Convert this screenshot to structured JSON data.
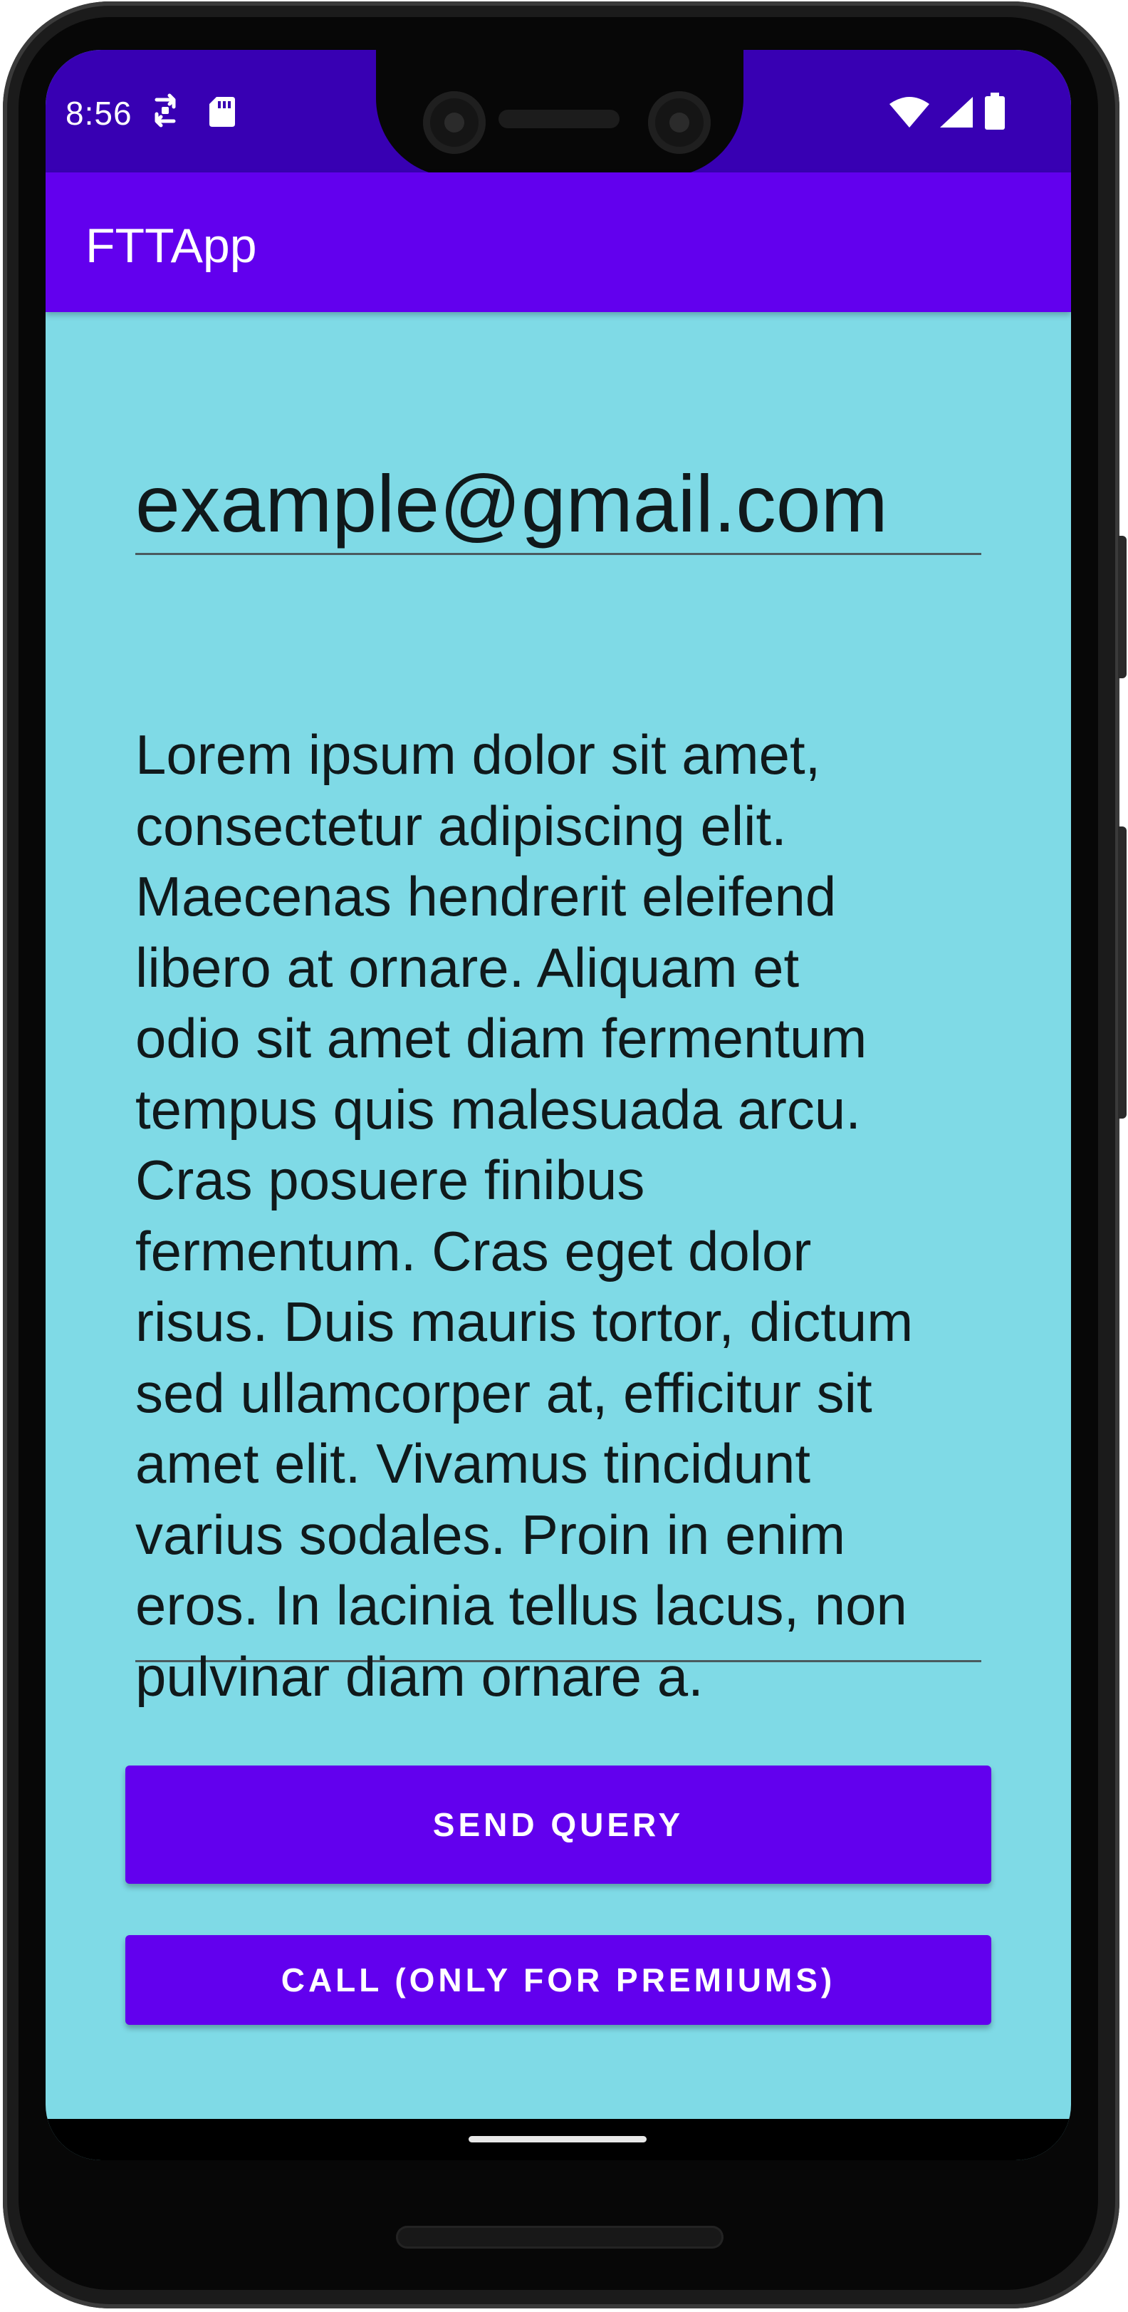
{
  "status_bar": {
    "time": "8:56",
    "icons": [
      "sync-icon",
      "sd-card-icon",
      "wifi-icon",
      "signal-icon",
      "battery-icon"
    ]
  },
  "app_bar": {
    "title": "FTTApp"
  },
  "form": {
    "email_value": "example@gmail.com",
    "message_value": "Lorem ipsum dolor sit amet,\nconsectetur adipiscing elit.\nMaecenas hendrerit eleifend\nlibero at ornare. Aliquam et\nodio sit amet diam fermentum\ntempus quis malesuada arcu.\nCras posuere finibus\nfermentum. Cras eget dolor\nrisus. Duis mauris tortor, dictum\nsed ullamcorper at, efficitur sit\namet elit. Vivamus tincidunt\nvarius sodales. Proin in enim\neros. In lacinia tellus lacus, non\npulvinar diam ornare a."
  },
  "buttons": {
    "send_label": "SEND QUERY",
    "call_label": "CALL (ONLY FOR PREMIUMS)"
  },
  "colors": {
    "status_bar": "#3800b3",
    "app_bar": "#6200ee",
    "background": "#7fdae6",
    "button": "#6200ee"
  }
}
